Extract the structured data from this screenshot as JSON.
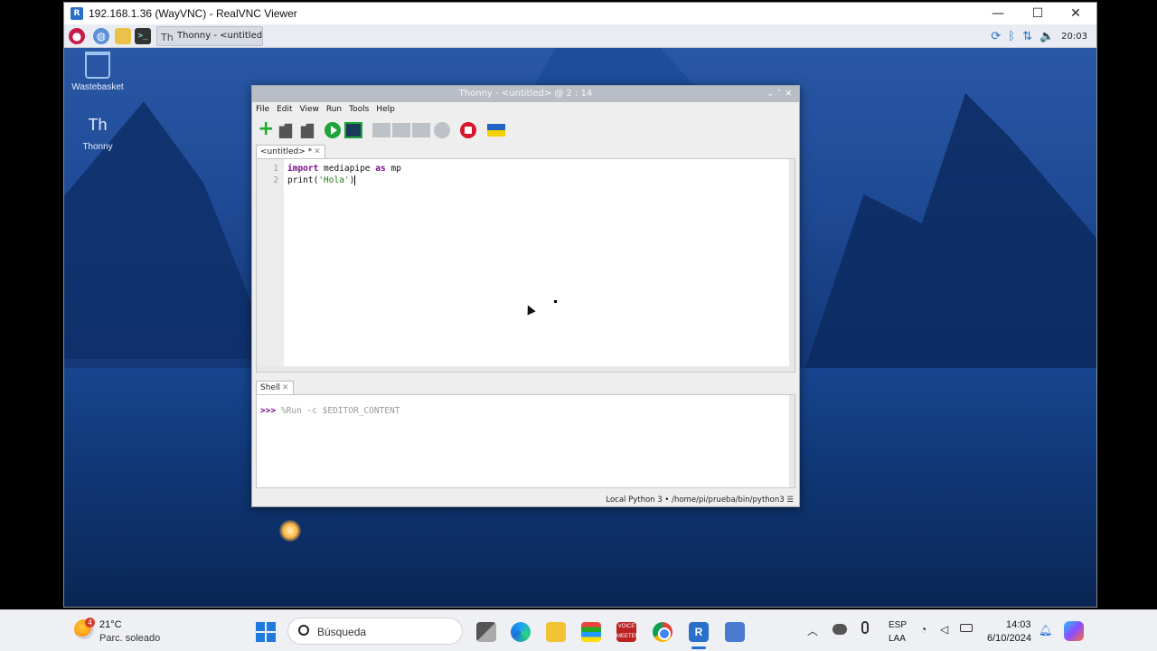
{
  "vnc": {
    "title": "192.168.1.36 (WayVNC) - RealVNC Viewer",
    "min": "—",
    "max": "☐",
    "close": "✕"
  },
  "pi_taskbar": {
    "thonny_task": "Thonny - <untitled> ...",
    "clock": "20:03"
  },
  "desktop": {
    "wastebasket": "Wastebasket",
    "thonny": "Thonny"
  },
  "thonny": {
    "title": "Thonny - <untitled> @ 2 : 14",
    "menu": [
      "File",
      "Edit",
      "View",
      "Run",
      "Tools",
      "Help"
    ],
    "editor_tab": "<untitled> *",
    "line_numbers": [
      "1",
      "2"
    ],
    "code_line1_kw1": "import",
    "code_line1_mod": " mediapipe ",
    "code_line1_kw2": "as",
    "code_line1_alias": " mp",
    "code_line2_func": "print(",
    "code_line2_str": "'Hola'",
    "code_line2_end": ")",
    "shell_tab": "Shell",
    "shell_prompt": ">>>",
    "shell_cmd": " %Run -c $EDITOR_CONTENT",
    "status": "Local Python 3  •  /home/pi/prueba/bin/python3  ☰"
  },
  "win_taskbar": {
    "weather_badge": "4",
    "temp": "21°C",
    "weather_desc": "Parc. soleado",
    "search_placeholder": "Búsqueda",
    "voicemeeter": "VOICE MEETER",
    "lang_a": "ESP",
    "lang_b": "LAA",
    "time": "14:03",
    "date": "6/10/2024"
  }
}
